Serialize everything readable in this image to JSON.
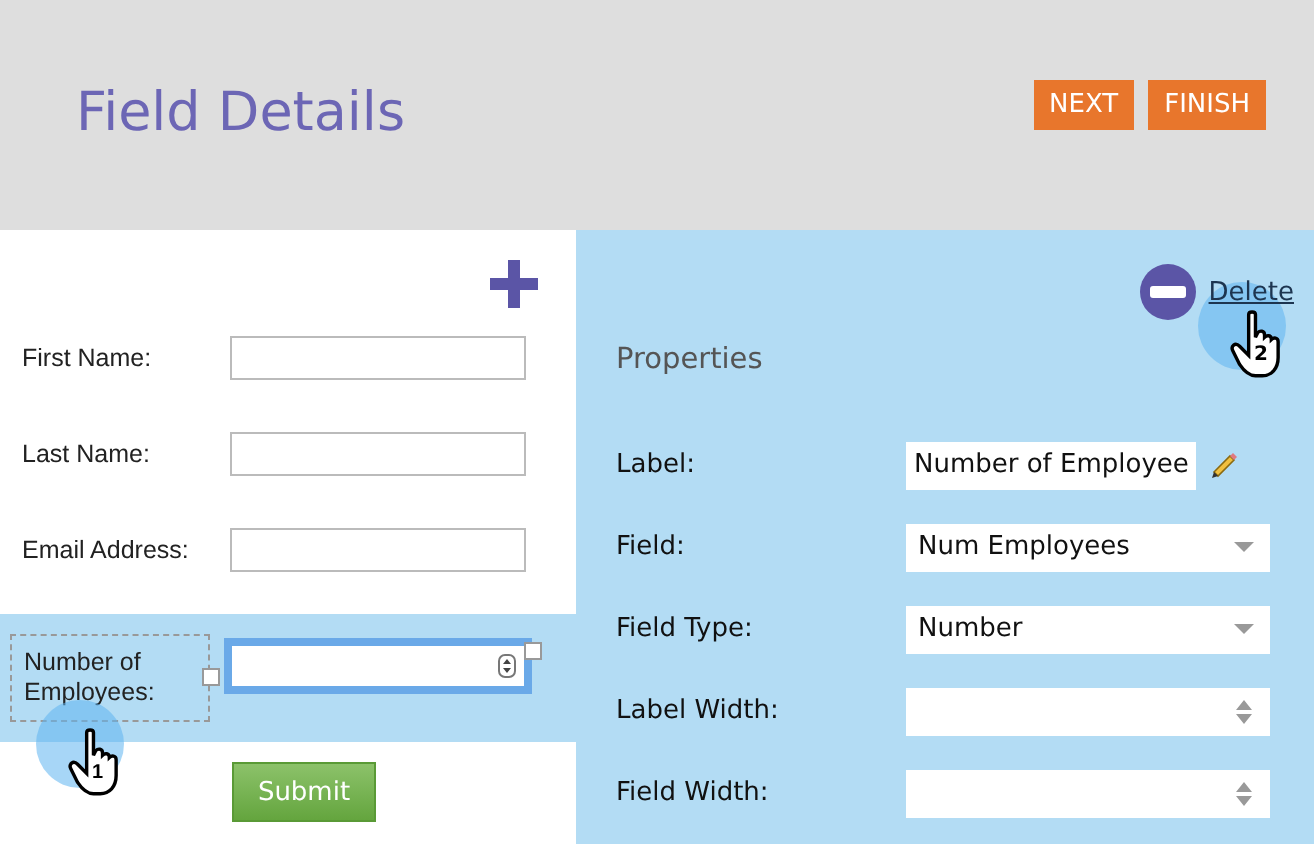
{
  "header": {
    "title": "Field Details",
    "buttons": [
      "NEXT",
      "FINISH"
    ]
  },
  "form": {
    "fields": [
      {
        "label": "First Name:",
        "kind": "text",
        "selected": false
      },
      {
        "label": "Last Name:",
        "kind": "text",
        "selected": false
      },
      {
        "label": "Email Address:",
        "kind": "text",
        "selected": false
      },
      {
        "label": "Number of Employees:",
        "kind": "number",
        "selected": true
      }
    ],
    "submit": "Submit"
  },
  "properties": {
    "delete": "Delete",
    "title": "Properties",
    "rows": [
      {
        "label": "Label:",
        "kind": "text",
        "value": "Number of Employee"
      },
      {
        "label": "Field:",
        "kind": "select",
        "value": "Num Employees"
      },
      {
        "label": "Field Type:",
        "kind": "select",
        "value": "Number"
      },
      {
        "label": "Label Width:",
        "kind": "spinner",
        "value": ""
      },
      {
        "label": "Field Width:",
        "kind": "spinner",
        "value": ""
      }
    ]
  },
  "callouts": [
    {
      "number": "1"
    },
    {
      "number": "2"
    }
  ]
}
